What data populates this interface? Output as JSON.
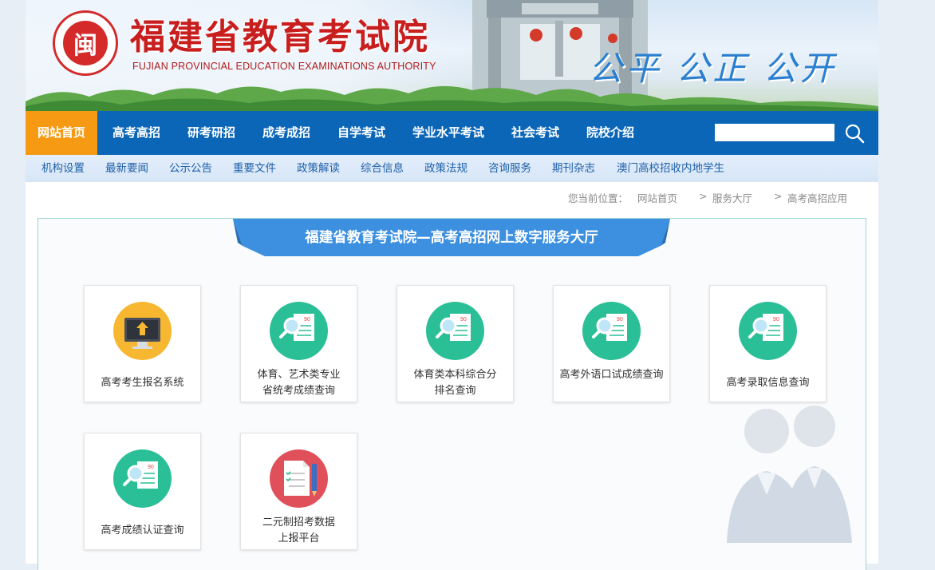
{
  "header": {
    "logo_glyph": "闽",
    "title": "福建省教育考试院",
    "subtitle": "FUJIAN PROVINCIAL EDUCATION EXAMINATIONS AUTHORITY",
    "slogan": "公平 公正 公开"
  },
  "nav": {
    "items": [
      "网站首页",
      "高考高招",
      "研考研招",
      "成考成招",
      "自学考试",
      "学业水平考试",
      "社会考试",
      "院校介绍"
    ],
    "active_index": 0,
    "search_placeholder": ""
  },
  "subnav": {
    "items": [
      "机构设置",
      "最新要闻",
      "公示公告",
      "重要文件",
      "政策解读",
      "综合信息",
      "政策法规",
      "咨询服务",
      "期刊杂志",
      "澳门高校招收内地学生"
    ]
  },
  "breadcrumb": {
    "prefix": "您当前位置：",
    "items": [
      "网站首页",
      "服务大厅",
      "高考高招应用"
    ],
    "separator": ">"
  },
  "hall": {
    "title": "福建省教育考试院—高考高招网上数字服务大厅",
    "cards": [
      {
        "line1": "高考考生报名系统",
        "line2": "",
        "icon": "computer-upload-icon"
      },
      {
        "line1": "体育、艺术类专业",
        "line2": "省统考成绩查询",
        "icon": "score-search-icon"
      },
      {
        "line1": "体育类本科综合分",
        "line2": "排名查询",
        "icon": "score-search-icon"
      },
      {
        "line1": "高考外语口试成绩查询",
        "line2": "",
        "icon": "score-search-icon"
      },
      {
        "line1": "高考录取信息查询",
        "line2": "",
        "icon": "score-search-icon"
      },
      {
        "line1": "高考成绩认证查询",
        "line2": "",
        "icon": "score-search-icon"
      },
      {
        "line1": "二元制招考数据",
        "line2": "上报平台",
        "icon": "document-pen-icon"
      }
    ]
  },
  "colors": {
    "nav_bg": "#0b66b8",
    "nav_active": "#f59a12",
    "title_red": "#c81e1e",
    "slogan_blue": "#2a7fd0",
    "teal_icon": "#2bbf97",
    "yellow_icon": "#f7b731",
    "red_icon": "#e0505a",
    "ribbon_blue": "#3d8fe0"
  }
}
